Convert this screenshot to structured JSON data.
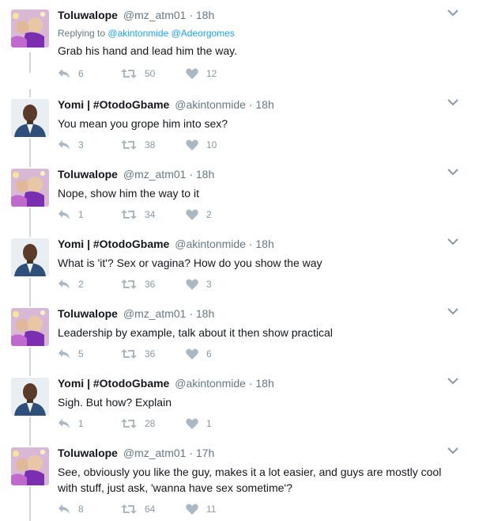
{
  "colors": {
    "text": "#14171a",
    "muted": "#657786",
    "link": "#1da1f2",
    "icon": "#aab8c2",
    "thread_line": "#ccd6dd"
  },
  "tweets": [
    {
      "name": "Toluwalope",
      "handle": "@mz_atm01",
      "time": "18h",
      "dot": "·",
      "replying_label": "Replying to",
      "replying_to_1": "@akintonmide",
      "replying_to_2": "@Adeorgomes",
      "text": "Grab his hand and lead him the way.",
      "replies": "6",
      "retweets": "50",
      "likes": "12",
      "avatar_icon": "profile-photo-woman"
    },
    {
      "name": "Yomi | #OtodoGbame",
      "handle": "@akintonmide",
      "time": "18h",
      "dot": "·",
      "text": "You mean you grope him into sex?",
      "replies": "3",
      "retweets": "38",
      "likes": "10",
      "avatar_icon": "profile-photo-man"
    },
    {
      "name": "Toluwalope",
      "handle": "@mz_atm01",
      "time": "18h",
      "dot": "·",
      "text": "Nope, show him the way to it",
      "replies": "1",
      "retweets": "34",
      "likes": "2",
      "avatar_icon": "profile-photo-woman"
    },
    {
      "name": "Yomi | #OtodoGbame",
      "handle": "@akintonmide",
      "time": "18h",
      "dot": "·",
      "text": "What is 'it'? Sex  or vagina? How do you show the way",
      "replies": "2",
      "retweets": "36",
      "likes": "3",
      "avatar_icon": "profile-photo-man"
    },
    {
      "name": "Toluwalope",
      "handle": "@mz_atm01",
      "time": "18h",
      "dot": "·",
      "text": "Leadership by example, talk about it then show practical",
      "replies": "5",
      "retweets": "36",
      "likes": "6",
      "avatar_icon": "profile-photo-woman"
    },
    {
      "name": "Yomi | #OtodoGbame",
      "handle": "@akintonmide",
      "time": "18h",
      "dot": "·",
      "text": "Sigh.  But how?  Explain",
      "replies": "1",
      "retweets": "28",
      "likes": "1",
      "avatar_icon": "profile-photo-man"
    },
    {
      "name": "Toluwalope",
      "handle": "@mz_atm01",
      "time": "17h",
      "dot": "·",
      "text": "See, obviously you like the guy, makes it a lot easier, and guys are mostly cool with stuff, just ask, 'wanna have sex sometime'?",
      "replies": "8",
      "retweets": "64",
      "likes": "11",
      "avatar_icon": "profile-photo-woman"
    }
  ]
}
